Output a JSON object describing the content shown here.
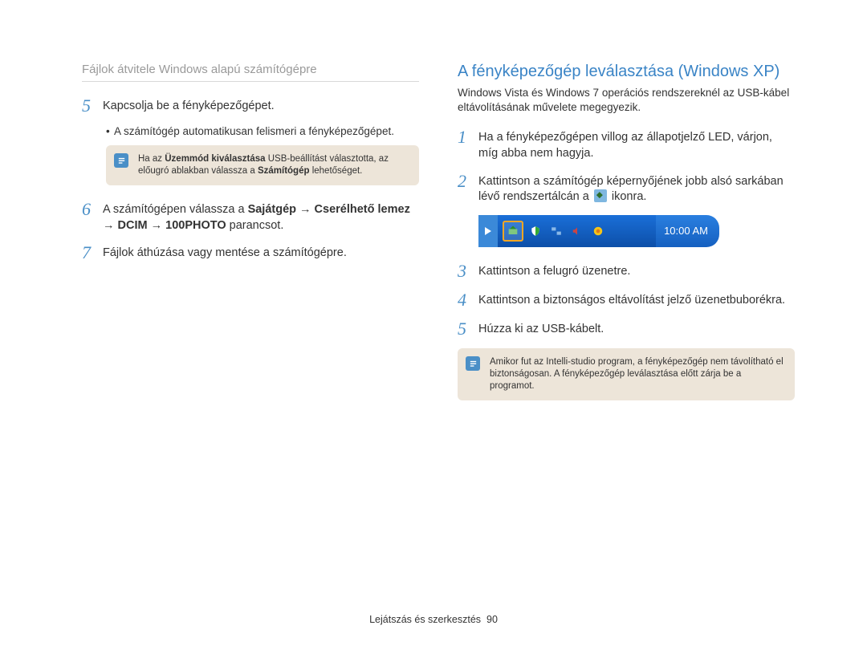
{
  "breadcrumb": "Fájlok átvitele Windows alapú számítógépre",
  "left": {
    "step5_num": "5",
    "step5_text": "Kapcsolja be a fényképezőgépet.",
    "step5_sub_prefix": "A számítógép automatikusan felismeri a fényképezőgépet.",
    "note1_prefix": "Ha az ",
    "note1_bold1": "Üzemmód kiválasztása",
    "note1_mid": " USB-beállítást választotta, az előugró ablakban válassza a ",
    "note1_bold2": "Számítógép",
    "note1_suffix": " lehetőséget.",
    "step6_num": "6",
    "step6_prefix": "A számítógépen válassza a ",
    "step6_bold": "Sajátgép → Cserélhető lemez → DCIM → 100PHOTO",
    "step6_suffix": " parancsot.",
    "step7_num": "7",
    "step7_text": "Fájlok áthúzása vagy mentése a számítógépre."
  },
  "right": {
    "title": "A fényképezőgép leválasztása (Windows XP)",
    "intro": "Windows Vista és Windows 7 operációs rendszereknél az USB-kábel eltávolításának művelete megegyezik.",
    "step1_num": "1",
    "step1_text": "Ha a fényképezőgépen villog az állapotjelző LED, várjon, míg abba nem hagyja.",
    "step2_num": "2",
    "step2_prefix": "Kattintson a számítógép képernyőjének jobb alsó sarkában lévő rendszertálcán a ",
    "step2_suffix": " ikonra.",
    "tray_time": "10:00 AM",
    "step3_num": "3",
    "step3_text": "Kattintson a felugró üzenetre.",
    "step4_num": "4",
    "step4_text": "Kattintson a biztonságos eltávolítást jelző üzenetbuborékra.",
    "step5_num": "5",
    "step5_text": "Húzza ki az USB-kábelt.",
    "note2": "Amikor fut az Intelli-studio program, a fényképezőgép nem távolítható el biztonságosan. A fényképezőgép leválasztása előtt zárja be a programot."
  },
  "footer_label": "Lejátszás és szerkesztés",
  "footer_page": "90"
}
